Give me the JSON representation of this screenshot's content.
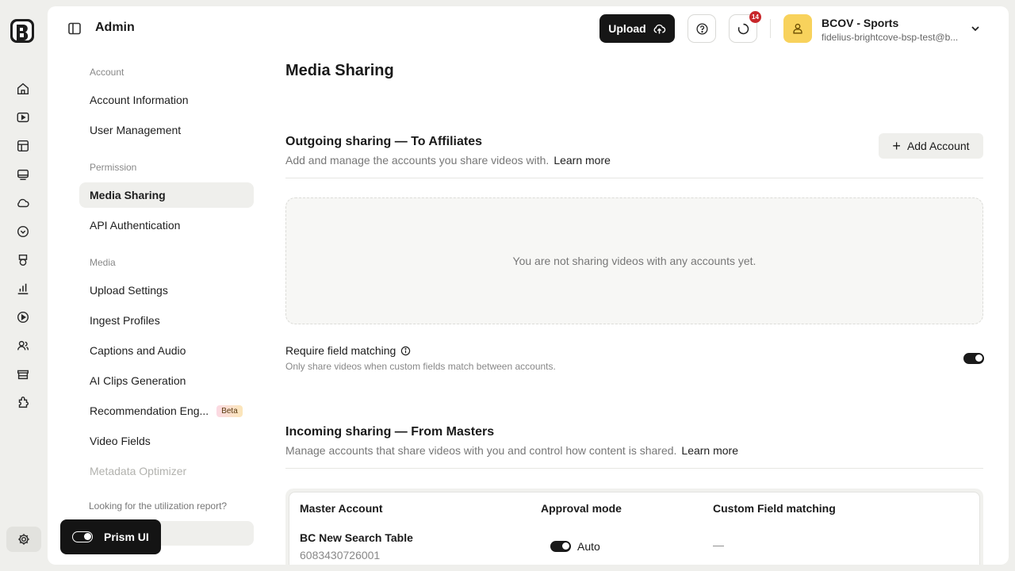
{
  "header": {
    "title": "Admin",
    "upload_label": "Upload",
    "notifications_count": "14",
    "account_name": "BCOV - Sports",
    "account_email": "fidelius-brightcove-bsp-test@b..."
  },
  "nav": {
    "sections": [
      {
        "label": "Account",
        "items": [
          "Account Information",
          "User Management"
        ]
      },
      {
        "label": "Permission",
        "items": [
          "Media Sharing",
          "API Authentication"
        ]
      },
      {
        "label": "Media",
        "items": [
          "Upload Settings",
          "Ingest Profiles",
          "Captions and Audio",
          "AI Clips Generation",
          "Recommendation Eng...",
          "Video Fields",
          "Metadata Optimizer"
        ]
      }
    ],
    "active_item": "Media Sharing",
    "beta_label": "Beta",
    "utilization_note": "Looking for the utilization report?"
  },
  "prism": {
    "label": "Prism UI"
  },
  "page": {
    "title": "Media Sharing",
    "outgoing": {
      "title": "Outgoing sharing — To Affiliates",
      "description": "Add and manage the accounts you share videos with.",
      "learn_more": "Learn more",
      "add_account_label": "Add Account",
      "empty_message": "You are not sharing videos with any accounts yet."
    },
    "field_matching": {
      "label": "Require field matching",
      "description": "Only share videos when custom fields match between accounts.",
      "enabled": true
    },
    "incoming": {
      "title": "Incoming sharing — From Masters",
      "description": "Manage accounts that share videos with you and control how content is shared.",
      "learn_more": "Learn more",
      "columns": [
        "Master Account",
        "Approval mode",
        "Custom Field matching"
      ],
      "rows": [
        {
          "name": "BC New Search Table",
          "id": "6083430726001",
          "approval_mode": "Auto",
          "custom_field_matching": "—"
        }
      ]
    }
  },
  "colors": {
    "accent_dark": "#161616",
    "avatar_yellow": "#f8d25c",
    "badge_red": "#c8262a",
    "background": "#efefec"
  }
}
